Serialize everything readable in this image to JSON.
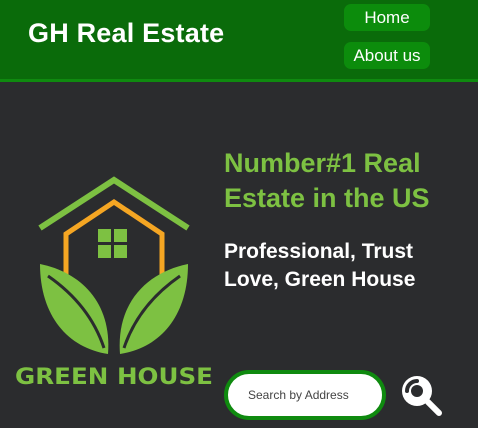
{
  "header": {
    "brand": "GH Real Estate",
    "nav": {
      "home_label": "Home",
      "about_label": "About us"
    }
  },
  "hero": {
    "headline_line1": "Number#1 Real",
    "headline_line2": "Estate in the US",
    "tagline_line1": "Professional, Trust",
    "tagline_line2": "Love, Green House"
  },
  "logo": {
    "text": "GREEN HOUSE",
    "icon": "house-leaves-icon"
  },
  "search": {
    "placeholder": "Search by Address",
    "value": "",
    "button_icon": "search-icon"
  },
  "colors": {
    "header_bg": "#0a6b0a",
    "nav_button_bg": "#0c8c0c",
    "page_bg": "#2b2c2e",
    "accent_green": "#7dc142",
    "house_orange": "#f5a623"
  }
}
